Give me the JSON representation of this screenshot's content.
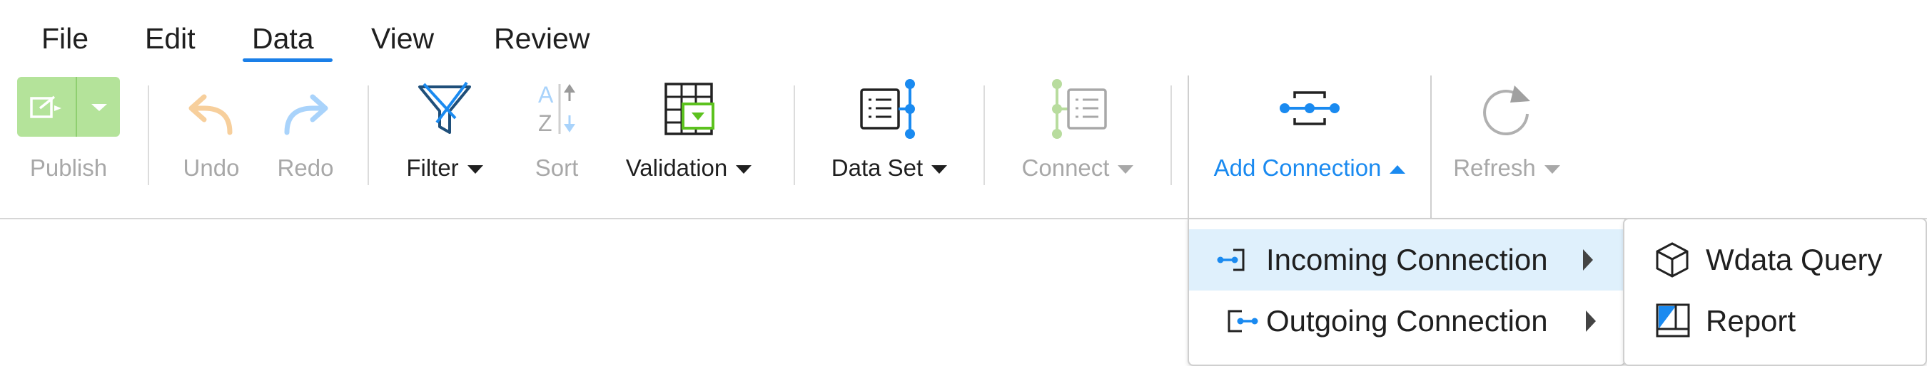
{
  "menu": {
    "items": [
      "File",
      "Edit",
      "Data",
      "View",
      "Review"
    ],
    "active": "Data"
  },
  "toolbar": {
    "publish_label": "Publish",
    "undo_label": "Undo",
    "redo_label": "Redo",
    "filter_label": "Filter",
    "sort_label": "Sort",
    "validation_label": "Validation",
    "dataset_label": "Data Set",
    "connect_label": "Connect",
    "add_connection_label": "Add Connection",
    "refresh_label": "Refresh",
    "sort_letters": {
      "a": "A",
      "z": "Z"
    }
  },
  "add_connection_menu": {
    "items": [
      "Incoming Connection",
      "Outgoing Connection"
    ],
    "highlighted": "Incoming Connection"
  },
  "incoming_submenu": {
    "items": [
      "Wdata Query",
      "Report"
    ]
  },
  "colors": {
    "accent": "#1a8af0",
    "publish_green": "#b4e39a",
    "validation_green": "#5cc21e",
    "highlight": "#dff0fc",
    "disabled": "#a8a8a8"
  },
  "icons": {
    "publish": "publish-icon",
    "undo": "undo-icon",
    "redo": "redo-icon",
    "filter": "filter-icon",
    "sort": "sort-icon",
    "validation": "validation-icon",
    "dataset": "dataset-icon",
    "connect": "connect-icon",
    "add_connection": "add-connection-icon",
    "refresh": "refresh-icon",
    "incoming": "incoming-connection-icon",
    "outgoing": "outgoing-connection-icon",
    "wdata_query": "cube-icon",
    "report": "report-icon"
  }
}
